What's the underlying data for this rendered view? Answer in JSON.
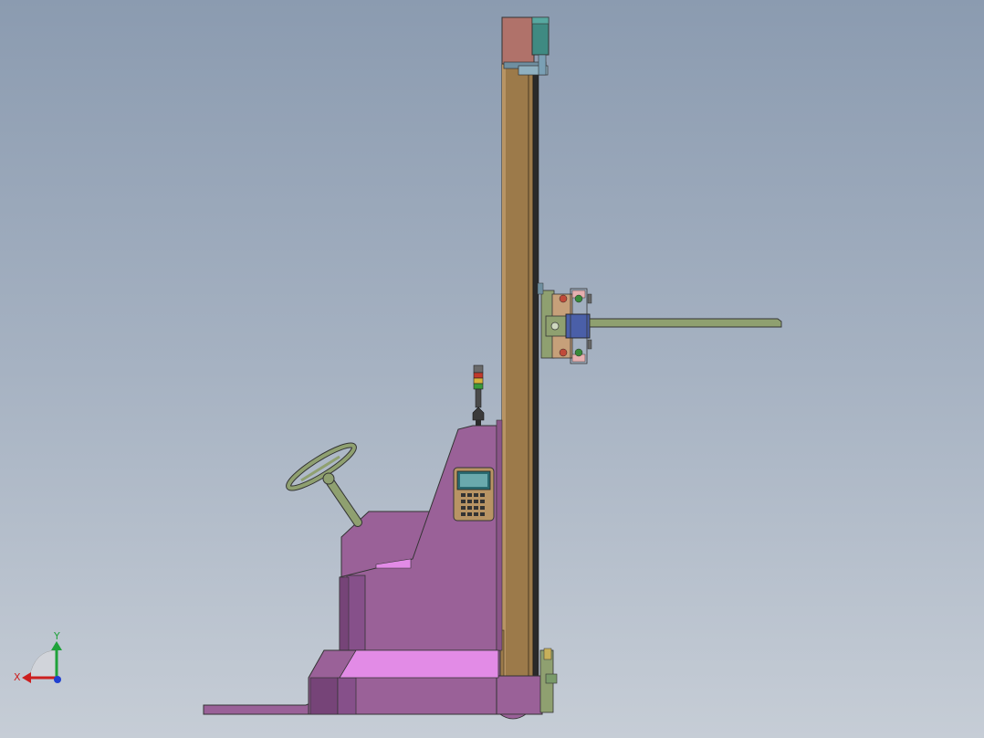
{
  "viewport": {
    "background_top": "#8b9bb0",
    "background_bottom": "#c6cdd6"
  },
  "model": {
    "parts": [
      "mast",
      "mast-top-motor",
      "carriage-assembly",
      "fork-arm",
      "chassis-body",
      "operator-floor",
      "front-fork-leg",
      "steering-wheel",
      "steering-column",
      "control-pendant",
      "signal-tower-light",
      "base-caster"
    ],
    "colors": {
      "mast": "#9c7a4a",
      "body": "#9a6198",
      "floor": "#e28be6",
      "motor": "#b0726a",
      "motor_side": "#3f8a82",
      "green_parts": "#8fa070",
      "carriage_blue": "#4a5fa8"
    }
  },
  "triad": {
    "x_label": "X",
    "y_label": "Y",
    "x_color": "#cc1f1f",
    "y_color": "#1fa23a",
    "z_color": "#1f3fd0"
  }
}
